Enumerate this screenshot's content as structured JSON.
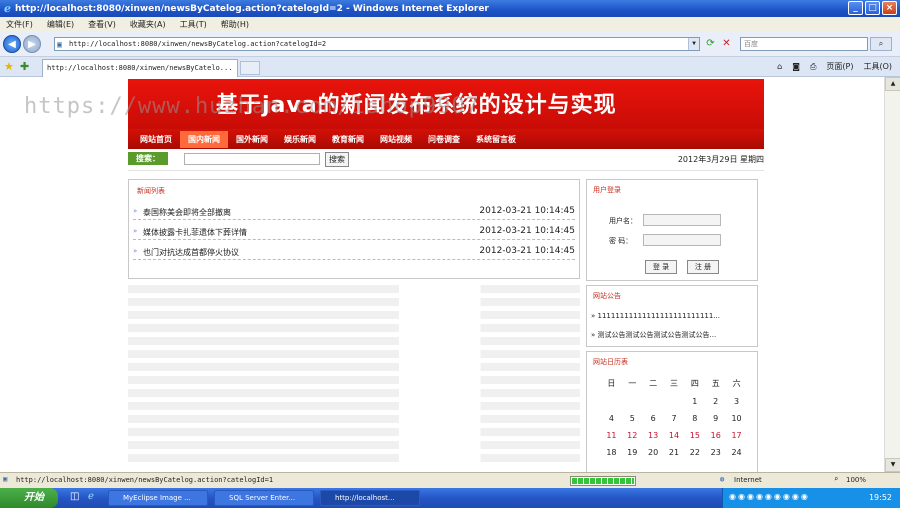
{
  "window": {
    "title": "http://localhost:8080/xinwen/newsByCatelog.action?catelogId=2 - Windows Internet Explorer",
    "buttons": [
      "_",
      "□",
      "×"
    ]
  },
  "menu": [
    "文件(F)",
    "编辑(E)",
    "查看(V)",
    "收藏夹(A)",
    "工具(T)",
    "帮助(H)"
  ],
  "address": {
    "url": "http://localhost:8080/xinwen/newsByCatelog.action?catelogId=2",
    "search_placeholder": "百度"
  },
  "tab": {
    "label": "http://localhost:8080/xinwen/newsByCatelo...",
    "page_menu": "页面(P)",
    "tools_menu": "工具(O)"
  },
  "site": {
    "watermark": "https://www.huzhan.com/ishop9907",
    "banner_title": "基于java的新闻发布系统的设计与实现",
    "nav": [
      "网站首页",
      "国内新闻",
      "国外新闻",
      "娱乐新闻",
      "教育新闻",
      "网站视频",
      "问卷调查",
      "系统留言板"
    ],
    "search_label": "搜索：",
    "search_button": "搜索",
    "date": "2012年3月29日  星期四",
    "news_list_title": "新闻列表",
    "news": [
      {
        "title": "泰国称美会即将全部撤离",
        "date": "2012-03-21 10:14:45"
      },
      {
        "title": "媒体披露卡扎菲遗体下葬详情",
        "date": "2012-03-21 10:14:45"
      },
      {
        "title": "也门对抗达成首都停火协议",
        "date": "2012-03-21 10:14:45"
      }
    ],
    "login": {
      "title": "用户登录",
      "username_label": "用户名：",
      "password_label": "密  码：",
      "login_button": "登 录",
      "register_button": "注 册"
    },
    "notice": {
      "title": "网站公告",
      "items": [
        "11111111111111111111111111...",
        "测试公告测试公告测试公告测试公告..."
      ]
    },
    "calendar": {
      "title": "网站日历表",
      "weekdays": [
        "日",
        "一",
        "二",
        "三",
        "四",
        "五",
        "六"
      ],
      "days": [
        "",
        "",
        "",
        "",
        "1",
        "2",
        "3",
        "4",
        "5",
        "6",
        "7",
        "8",
        "9",
        "10",
        "11",
        "12",
        "13",
        "14",
        "15",
        "16",
        "17",
        "18",
        "19",
        "20",
        "21",
        "22",
        "23",
        "24"
      ]
    }
  },
  "status": {
    "text": "http://localhost:8080/xinwen/newsByCatelog.action?catelogId=1",
    "zone": "Internet",
    "zoom": "100%"
  },
  "taskbar": {
    "start": "开始",
    "items": [
      "MyEclipse Image ...",
      "SQL Server Enter...",
      "http://localhost..."
    ],
    "clock": "19:52"
  }
}
